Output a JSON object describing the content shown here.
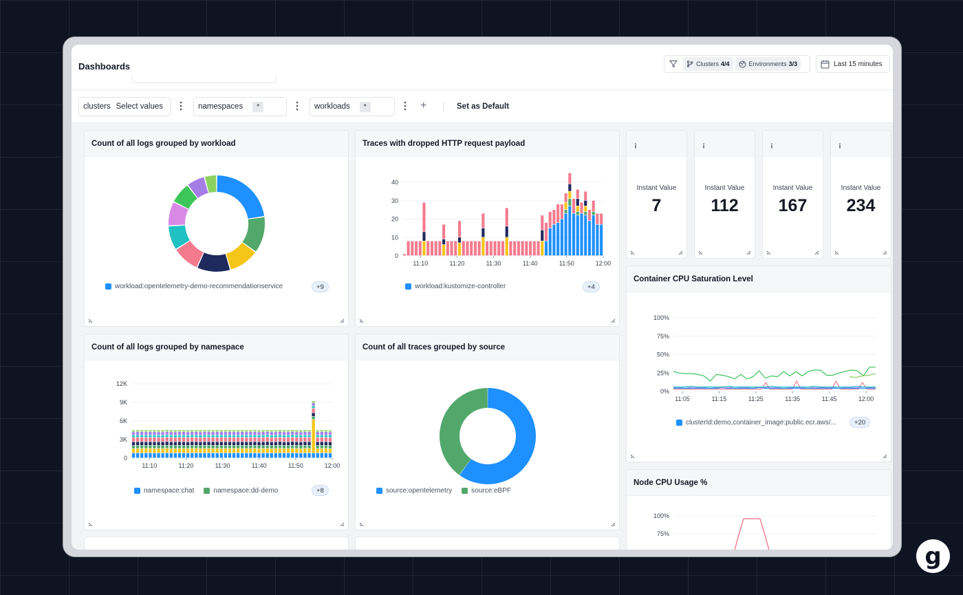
{
  "header": {
    "title": "Dashboards",
    "clusters_label": "Clusters",
    "clusters_value": "4/4",
    "environments_label": "Environments",
    "environments_value": "3/3",
    "time_range": "Last 15 minutes"
  },
  "filters": {
    "clusters_label": "clusters",
    "clusters_value": "Select values",
    "namespaces_label": "namespaces",
    "namespaces_value": "*",
    "workloads_label": "workloads",
    "workloads_value": "*",
    "set_default": "Set as Default"
  },
  "panels": {
    "logs_by_workload": {
      "title": "Count of all logs grouped by workload",
      "legend": "workload:opentelemetry-demo-recommendationservice",
      "more": "+9"
    },
    "dropped_http": {
      "title": "Traces with dropped HTTP request payload",
      "legend": "workload:kustomize-controller",
      "more": "+4"
    },
    "stats": [
      {
        "label": "Instant Value",
        "value": "7",
        "icon": "info-icon"
      },
      {
        "label": "Instant Value",
        "value": "112",
        "icon": "info-icon"
      },
      {
        "label": "Instant Value",
        "value": "167",
        "icon": "info-icon"
      },
      {
        "label": "Instant Value",
        "value": "234",
        "icon": "info-icon"
      }
    ],
    "cpu_saturation": {
      "title": "Container CPU Saturation Level",
      "legend": "clusterId:demo,container_image:public.ecr.aws/...",
      "more": "+20"
    },
    "logs_by_namespace": {
      "title": "Count of all logs grouped by namespace",
      "legend_1": "namespace:chat",
      "legend_2": "namespace:dd-demo",
      "more": "+8"
    },
    "traces_by_source": {
      "title": "Count of all traces grouped by source",
      "legend_1": "source:opentelemetry",
      "legend_2": "source:eBPF"
    },
    "node_cpu": {
      "title": "Node CPU Usage %"
    }
  },
  "colors": {
    "blue": "#1e90ff",
    "green": "#52a86b",
    "yellow": "#f5c518",
    "navy": "#1f2a5c",
    "pink": "#f47b8e",
    "teal": "#1fc1c3",
    "violet": "#d889e6",
    "purple": "#a67de6",
    "lime": "#8bd160",
    "bright_green": "#3cc65a"
  },
  "chart_data": [
    {
      "type": "pie",
      "title": "Count of all logs grouped by workload",
      "donut": true,
      "values": [
        22,
        12,
        10,
        11,
        9,
        8,
        8,
        7,
        6,
        4
      ],
      "colors": [
        "#1e90ff",
        "#52a86b",
        "#f5c518",
        "#1f2a5c",
        "#f47b8e",
        "#1fc1c3",
        "#d889e6",
        "#3cc65a",
        "#a67de6",
        "#8bd160"
      ]
    },
    {
      "type": "bar",
      "stacked": true,
      "title": "Traces with dropped HTTP request payload",
      "ylim": [
        0,
        40
      ],
      "yticks": [
        0,
        10,
        20,
        30,
        40
      ],
      "xticks": [
        "11:10",
        "11:20",
        "11:30",
        "11:40",
        "11:50",
        "12:00"
      ],
      "series": [
        {
          "color": "#1e90ff",
          "values": [
            0,
            0,
            0,
            0,
            0,
            0,
            0,
            0,
            0,
            0,
            0,
            0,
            0,
            0,
            0,
            0,
            0,
            0,
            0,
            0,
            0,
            0,
            0,
            0,
            0,
            0,
            0,
            0,
            0,
            0,
            0,
            0,
            0,
            0,
            0,
            0,
            8,
            15,
            17,
            18,
            20,
            23,
            27,
            23,
            22,
            23,
            22,
            19,
            22,
            17,
            17
          ]
        },
        {
          "color": "#52a86b",
          "values": [
            0,
            0,
            0,
            0,
            0,
            0,
            0,
            0,
            0,
            0,
            0,
            0,
            0,
            0,
            0,
            0,
            0,
            0,
            0,
            0,
            0,
            0,
            0,
            0,
            0,
            0,
            0,
            0,
            0,
            0,
            0,
            0,
            0,
            0,
            0,
            0,
            0,
            0,
            0,
            0,
            0,
            2,
            4,
            0,
            2,
            0,
            2,
            0,
            2,
            0,
            0
          ]
        },
        {
          "color": "#f5c518",
          "values": [
            0,
            0,
            0,
            0,
            0,
            8,
            0,
            0,
            0,
            0,
            6,
            0,
            0,
            0,
            7,
            0,
            0,
            0,
            0,
            0,
            10,
            0,
            0,
            0,
            0,
            0,
            10,
            0,
            0,
            0,
            0,
            0,
            0,
            0,
            0,
            8,
            0,
            0,
            0,
            0,
            0,
            4,
            4,
            0,
            3,
            0,
            3,
            0,
            0,
            0,
            0
          ]
        },
        {
          "color": "#1f2a5c",
          "values": [
            0,
            0,
            0,
            0,
            0,
            5,
            0,
            0,
            0,
            0,
            3,
            0,
            0,
            0,
            3,
            0,
            0,
            0,
            0,
            0,
            5,
            0,
            0,
            0,
            0,
            0,
            6,
            0,
            0,
            0,
            0,
            0,
            0,
            0,
            0,
            6,
            0,
            0,
            0,
            0,
            0,
            0,
            4,
            0,
            4,
            0,
            3,
            0,
            0,
            0,
            0
          ]
        },
        {
          "color": "#f47b8e",
          "values": [
            1,
            8,
            8,
            8,
            8,
            16,
            8,
            8,
            8,
            8,
            8,
            8,
            8,
            8,
            9,
            8,
            8,
            8,
            8,
            8,
            8,
            8,
            8,
            8,
            8,
            8,
            10,
            8,
            8,
            8,
            8,
            8,
            8,
            8,
            8,
            8,
            10,
            9,
            8,
            10,
            8,
            5,
            6,
            8,
            5,
            6,
            5,
            6,
            6,
            6,
            6
          ]
        }
      ]
    },
    {
      "type": "line",
      "title": "Container CPU Saturation Level",
      "ylim": [
        0,
        100
      ],
      "yticks": [
        "0%",
        "25%",
        "50%",
        "75%",
        "100%"
      ],
      "xticks": [
        "11:05",
        "11:15",
        "11:25",
        "11:35",
        "11:45",
        "12:00"
      ],
      "series": [
        {
          "color": "#3cc65a",
          "values": [
            27,
            25,
            24,
            24,
            23,
            21,
            14,
            23,
            22,
            20,
            17,
            23,
            17,
            20,
            28,
            18,
            21,
            20,
            27,
            21,
            27,
            21,
            27,
            29,
            29,
            22,
            22,
            25,
            27,
            29,
            28,
            21,
            33,
            33
          ]
        },
        {
          "color": "#f47b8e",
          "values": [
            3,
            3,
            3,
            3,
            3,
            3,
            3,
            3,
            3,
            3,
            3,
            3,
            3,
            3,
            3,
            3,
            3,
            3,
            3,
            3,
            3,
            12,
            3,
            3,
            3,
            3,
            3,
            3,
            14,
            3,
            3,
            3,
            3,
            3,
            3,
            3,
            3,
            14,
            3,
            3,
            3,
            3,
            3,
            12,
            3,
            3,
            3
          ]
        },
        {
          "color": "#1e90ff",
          "values": [
            4,
            4,
            4,
            4,
            4,
            4,
            4,
            4,
            5,
            4,
            4,
            4,
            4,
            4,
            5,
            4,
            4,
            4,
            4,
            4,
            4,
            4,
            4,
            4,
            4,
            4,
            4,
            4,
            4,
            4,
            4,
            4,
            4,
            4
          ]
        },
        {
          "color": "#a67de6",
          "values": [
            5,
            5,
            6,
            5,
            5,
            5,
            6,
            5,
            5,
            5,
            6,
            5,
            5,
            6,
            5,
            5,
            5,
            5,
            6,
            5,
            5,
            5,
            6,
            5,
            5,
            5,
            5,
            6,
            5,
            5,
            5,
            6,
            5,
            5
          ]
        },
        {
          "color": "#1fc1c3",
          "values": [
            6,
            6,
            6,
            7,
            6,
            6,
            6,
            6,
            6,
            7,
            6,
            6,
            6,
            6,
            6,
            6,
            7,
            6,
            6,
            6,
            6,
            6,
            6,
            7,
            6,
            6,
            6,
            6,
            6,
            6,
            7,
            6,
            6,
            6
          ]
        },
        {
          "color": "#8bd160",
          "values": [
            20,
            19,
            21,
            22,
            24
          ]
        }
      ]
    },
    {
      "type": "bar",
      "stacked": true,
      "title": "Count of all logs grouped by namespace",
      "ylim": [
        0,
        12000
      ],
      "yticks": [
        "0",
        "3K",
        "6K",
        "9K",
        "12K"
      ],
      "xticks": [
        "11:10",
        "11:20",
        "11:30",
        "11:40",
        "11:50",
        "12:00"
      ],
      "series": [
        {
          "color": "#1e90ff",
          "values": [
            800,
            820,
            800,
            810,
            820,
            800,
            810,
            800,
            820,
            810,
            800,
            810,
            820,
            800,
            810,
            820,
            800,
            810,
            820,
            810,
            800,
            810,
            820,
            800,
            810,
            820,
            800,
            810,
            820,
            810,
            800,
            810,
            820,
            800,
            810,
            820,
            800,
            810,
            820,
            810,
            800,
            810,
            820,
            800,
            810,
            820,
            800,
            800
          ]
        },
        {
          "color": "#f5c518",
          "values": [
            700,
            700,
            720,
            700,
            700,
            720,
            700,
            700,
            720,
            700,
            700,
            720,
            700,
            700,
            720,
            700,
            700,
            720,
            700,
            700,
            720,
            700,
            700,
            720,
            700,
            700,
            720,
            700,
            700,
            720,
            700,
            700,
            720,
            700,
            700,
            720,
            700,
            700,
            720,
            700,
            700,
            720,
            700,
            5400,
            700,
            700,
            720,
            700
          ]
        },
        {
          "color": "#52a86b",
          "values": [
            500,
            500,
            500,
            500,
            500,
            500,
            500,
            500,
            500,
            500,
            500,
            500,
            500,
            500,
            500,
            500,
            500,
            500,
            500,
            500,
            500,
            500,
            500,
            500,
            500,
            500,
            500,
            500,
            500,
            500,
            500,
            500,
            500,
            500,
            500,
            500,
            500,
            500,
            500,
            500,
            500,
            500,
            500,
            500,
            500,
            500,
            500,
            500
          ]
        },
        {
          "color": "#1f2a5c",
          "values": [
            600,
            600,
            600,
            600,
            600,
            600,
            600,
            600,
            600,
            600,
            600,
            600,
            600,
            600,
            600,
            600,
            600,
            600,
            600,
            600,
            600,
            600,
            600,
            600,
            600,
            600,
            600,
            600,
            600,
            600,
            600,
            600,
            600,
            600,
            600,
            600,
            600,
            600,
            600,
            600,
            600,
            600,
            600,
            600,
            600,
            600,
            600,
            600
          ]
        },
        {
          "color": "#f47b8e",
          "values": [
            700,
            700,
            700,
            700,
            700,
            700,
            700,
            700,
            700,
            700,
            700,
            700,
            700,
            700,
            700,
            700,
            700,
            700,
            700,
            700,
            700,
            700,
            700,
            700,
            700,
            700,
            700,
            700,
            700,
            700,
            700,
            700,
            700,
            700,
            700,
            700,
            700,
            700,
            700,
            700,
            700,
            700,
            700,
            700,
            700,
            700,
            700,
            700
          ]
        },
        {
          "color": "#1fc1c3",
          "values": [
            400,
            400,
            400,
            400,
            400,
            400,
            400,
            400,
            400,
            400,
            400,
            400,
            400,
            400,
            400,
            400,
            400,
            400,
            400,
            400,
            400,
            400,
            400,
            400,
            400,
            400,
            400,
            400,
            400,
            400,
            400,
            400,
            400,
            400,
            400,
            400,
            400,
            400,
            400,
            400,
            400,
            400,
            400,
            400,
            400,
            400,
            400,
            400
          ]
        },
        {
          "color": "#a67de6",
          "values": [
            500,
            500,
            500,
            500,
            500,
            500,
            500,
            500,
            500,
            500,
            500,
            500,
            500,
            500,
            500,
            500,
            500,
            500,
            500,
            500,
            500,
            500,
            500,
            500,
            500,
            500,
            500,
            500,
            500,
            500,
            500,
            500,
            500,
            500,
            500,
            500,
            500,
            500,
            500,
            500,
            500,
            500,
            500,
            500,
            500,
            500,
            500,
            500
          ]
        },
        {
          "color": "#8bd160",
          "values": [
            300,
            300,
            300,
            300,
            300,
            300,
            300,
            300,
            300,
            300,
            300,
            300,
            300,
            300,
            300,
            300,
            300,
            300,
            300,
            300,
            300,
            300,
            300,
            300,
            300,
            300,
            300,
            300,
            300,
            300,
            300,
            300,
            300,
            300,
            300,
            300,
            300,
            300,
            300,
            300,
            300,
            300,
            300,
            300,
            300,
            300,
            300,
            300
          ]
        }
      ]
    },
    {
      "type": "pie",
      "title": "Count of all traces grouped by source",
      "donut": true,
      "values": [
        60,
        40
      ],
      "colors": [
        "#1e90ff",
        "#52a86b"
      ]
    },
    {
      "type": "line",
      "title": "Node CPU Usage %",
      "ylim": [
        0,
        100
      ],
      "yticks": [
        "75%",
        "100%"
      ],
      "series": [
        {
          "color": "#f47b8e",
          "values": [
            0,
            0,
            0,
            0,
            0,
            0,
            0,
            0,
            70,
            96,
            96,
            96,
            96,
            70,
            0,
            0
          ]
        }
      ]
    }
  ]
}
